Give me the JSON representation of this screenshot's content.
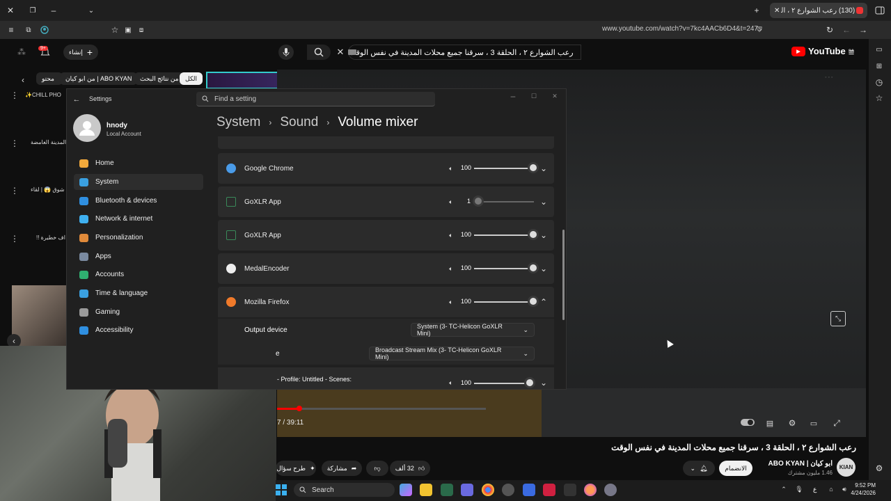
{
  "browser": {
    "tab_title": "(130) رعب الشوارع ٢ ، الحلقة 3 ، ...",
    "url": "www.youtube.com/watch?v=7kc4AACb6D4&t=247s"
  },
  "youtube": {
    "search_value": "رعب الشوارع ٢ ، الحلقة 3 ، سرقنا جميع محلات المدينة في نفس الوقت",
    "logo_text": "YouTube",
    "logo_region": "SA",
    "create_label": "إنشاء",
    "notif_count": "9+",
    "chips": [
      "الكل",
      "من نتائج البحث",
      "من ابو كيان | ABO KYAN",
      "محتو"
    ],
    "sidebar_items": [
      "CHILL PHO✨",
      "المدينة الغامضة",
      "شوق 😱 | لقاء",
      "اف خطيرة !!"
    ],
    "video_time": "7 / 39:11",
    "video_title": "رعب الشوارع ٢ ، الحلقة 3 ، سرقنا جميع محلات المدينة في نفس الوقت",
    "channel_name": "ابو كيان | ABO KYAN",
    "subscribers": "1.46 مليون مشترك",
    "join_label": "الانضمام",
    "like_count": "32 ألف",
    "share_label": "مشاركة",
    "ask_label": "طرح سؤال"
  },
  "settings": {
    "window_title": "Settings",
    "search_placeholder": "Find a setting",
    "user_name": "hnody",
    "account_type": "Local Account",
    "nav": [
      {
        "label": "Home",
        "color": "#f2a93b"
      },
      {
        "label": "System",
        "color": "#3aa0e0"
      },
      {
        "label": "Bluetooth & devices",
        "color": "#2f8fe0"
      },
      {
        "label": "Network & internet",
        "color": "#3fb0f0"
      },
      {
        "label": "Personalization",
        "color": "#e08a3a"
      },
      {
        "label": "Apps",
        "color": "#7a8aa0"
      },
      {
        "label": "Accounts",
        "color": "#2fb070"
      },
      {
        "label": "Time & language",
        "color": "#3aa0e0"
      },
      {
        "label": "Gaming",
        "color": "#9a9a9a"
      },
      {
        "label": "Accessibility",
        "color": "#2f8fe0"
      }
    ],
    "breadcrumb": [
      "System",
      "Sound",
      "Volume mixer"
    ],
    "apps": [
      {
        "name": "Google Chrome",
        "volume": "100",
        "color": "#4a9be8"
      },
      {
        "name": "GoXLR App",
        "volume": "1",
        "color": "#3a8a5a"
      },
      {
        "name": "GoXLR App",
        "volume": "100",
        "color": "#3a8a5a"
      },
      {
        "name": "MedalEncoder",
        "volume": "100",
        "color": "#eeeeee"
      },
      {
        "name": "Mozilla Firefox",
        "volume": "100",
        "color": "#f07a2a"
      }
    ],
    "output_device_label": "Output device",
    "output_device_value": "System (3- TC-Helicon GoXLR Mini)",
    "input_device_label": "e",
    "input_device_value": "Broadcast Stream Mix (3- TC-Helicon GoXLR Mini)",
    "obs_row_label": "- Profile: Untitled - Scenes:",
    "obs_volume": "100"
  },
  "taskbar": {
    "search_label": "Search",
    "time": "9:52 PM",
    "date": "4/24/2026",
    "lang": "ع"
  }
}
